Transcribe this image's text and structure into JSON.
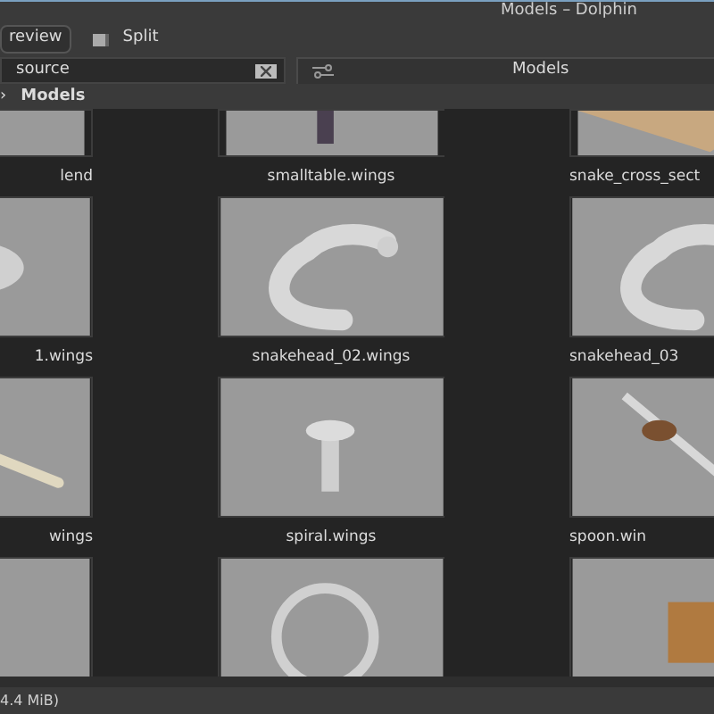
{
  "window": {
    "title": "Models – Dolphin"
  },
  "toolbar": [
    {
      "label": "review",
      "kind": "button",
      "selected": true
    },
    {
      "label": "Split",
      "kind": "split",
      "selected": false
    }
  ],
  "search": {
    "value": "source"
  },
  "location_tab": {
    "label": "Models"
  },
  "breadcrumb": {
    "arrow": "›",
    "label": "Models"
  },
  "files": [
    {
      "name": "lend",
      "kind": "picture"
    },
    {
      "name": "smalltable.wings",
      "kind": "picture"
    },
    {
      "name": "snake_cross_sect",
      "kind": "picture"
    },
    {
      "name": "1.wings",
      "kind": "picture"
    },
    {
      "name": "snakehead_02.wings",
      "kind": "picture"
    },
    {
      "name": "snakehead_03",
      "kind": "picture"
    },
    {
      "name": "wings",
      "kind": "picture"
    },
    {
      "name": "spiral.wings",
      "kind": "picture"
    },
    {
      "name": "spoon.win",
      "kind": "picture"
    },
    {
      "kind": "picture"
    },
    {
      "kind": "picture"
    },
    {
      "kind": "picture"
    }
  ],
  "status": {
    "text": "4.4 MiB)"
  }
}
